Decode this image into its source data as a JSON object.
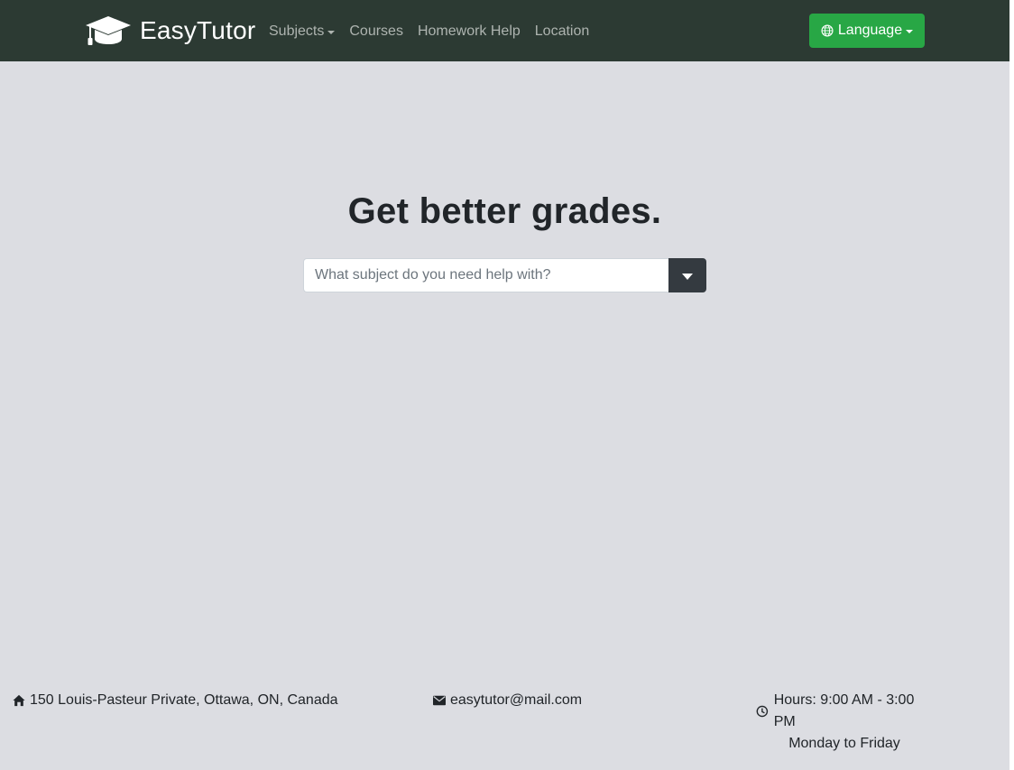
{
  "brand": {
    "name": "EasyTutor",
    "icon": "graduation-cap-icon"
  },
  "nav": {
    "items": [
      {
        "label": "Subjects",
        "dropdown": true
      },
      {
        "label": "Courses"
      },
      {
        "label": "Homework Help"
      },
      {
        "label": "Location"
      }
    ]
  },
  "language_button": {
    "label": "Language",
    "icon": "globe-icon"
  },
  "hero": {
    "title": "Get better grades.",
    "search_placeholder": "What subject do you need help with?"
  },
  "footer": {
    "address": "150 Louis-Pasteur Private, Ottawa, ON, Canada",
    "email": "easytutor@mail.com",
    "hours": "Hours: 9:00 AM - 3:00 PM",
    "days": "Monday to Friday"
  },
  "colors": {
    "navbar": "#2c3a33",
    "background": "#dcdde2",
    "language_button": "#28a745",
    "search_toggle": "#343a40"
  }
}
